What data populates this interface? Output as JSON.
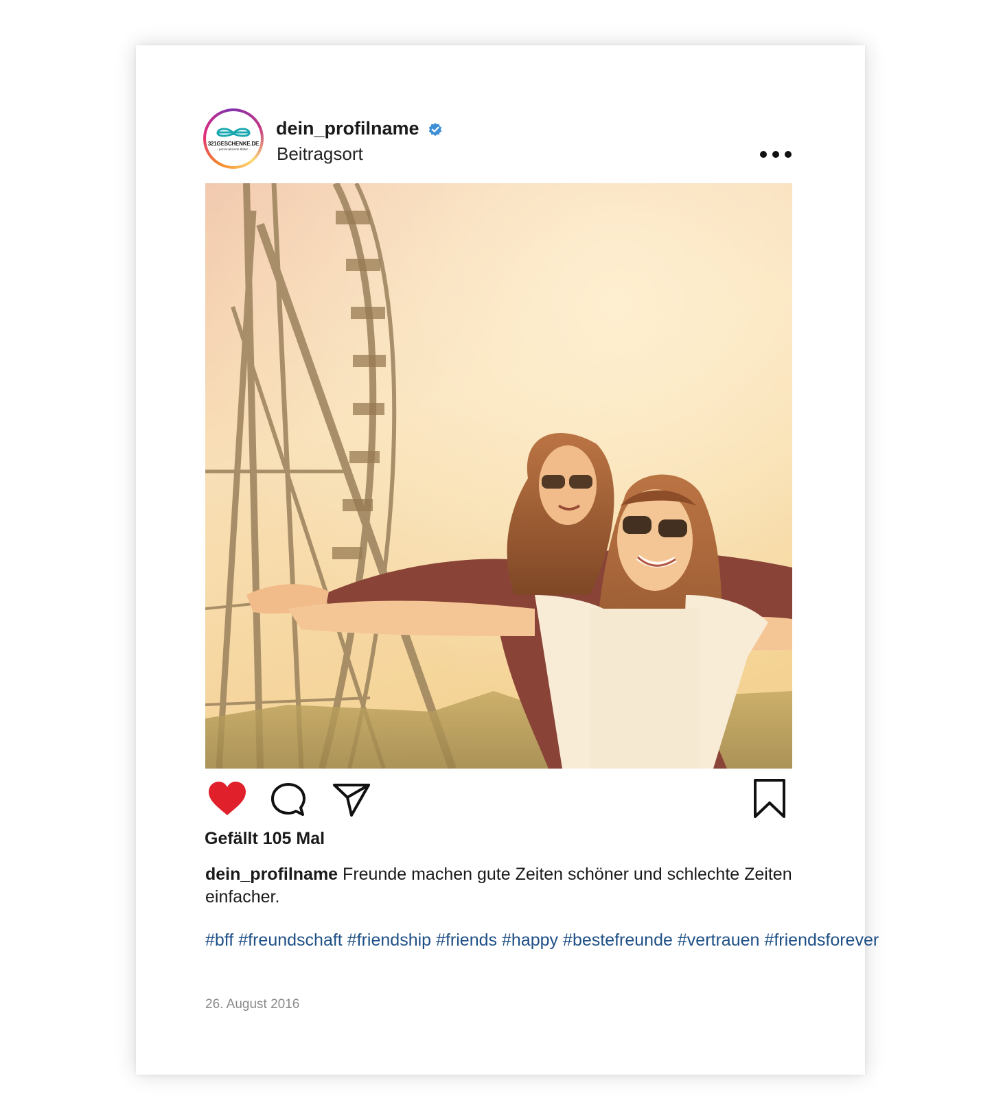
{
  "post": {
    "profile_name": "dein_profilname",
    "location": "Beitragsort",
    "avatar": {
      "brand": "321GESCHENKE.DE",
      "subtitle": "- personalisierte Bilder -",
      "brand_color": "#1aa8b0"
    },
    "verified_icon": "verified-badge-icon",
    "more_icon": "more-options-icon",
    "photo_description_icon": "photo",
    "actions": {
      "like_icon": "heart-icon",
      "like_state": "liked",
      "like_color": "#e0202b",
      "comment_icon": "comment-icon",
      "share_icon": "send-icon",
      "save_icon": "bookmark-icon"
    },
    "likes_text": "Gefällt 105 Mal",
    "caption_user": "dein_profilname",
    "caption_text": "Freunde machen gute Zeiten schöner und schlechte Zeiten einfacher.",
    "hashtags": [
      "#bff",
      "#freundschaft",
      "#friendship",
      "#friends",
      "#happy",
      "#bestefreunde",
      "#vertrauen",
      "#friendsforever"
    ],
    "hashtag_color": "#1e4f86",
    "date": "26. August 2016"
  }
}
